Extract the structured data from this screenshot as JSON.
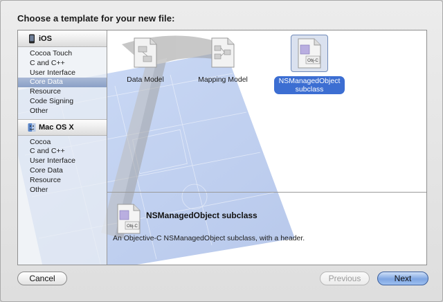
{
  "dialog": {
    "heading": "Choose a template for your new file:"
  },
  "sidebar": {
    "groups": [
      {
        "name": "iOS",
        "icon": "device-icon",
        "items": [
          "Cocoa Touch",
          "C and C++",
          "User Interface",
          "Core Data",
          "Resource",
          "Code Signing",
          "Other"
        ],
        "selected": "Core Data"
      },
      {
        "name": "Mac OS X",
        "icon": "finder-icon",
        "items": [
          "Cocoa",
          "C and C++",
          "User Interface",
          "Core Data",
          "Resource",
          "Other"
        ]
      }
    ]
  },
  "templates": [
    {
      "label": "Data Model",
      "icon": "data-model-document-icon"
    },
    {
      "label": "Mapping Model",
      "icon": "mapping-model-document-icon"
    },
    {
      "label_line1": "NSManagedObject",
      "label_line2": "subclass",
      "icon": "objc-class-document-icon",
      "badge": "Obj-C",
      "selected": true
    }
  ],
  "detail": {
    "title": "NSManagedObject subclass",
    "description": "An Objective-C NSManagedObject subclass, with a header.",
    "badge": "Obj-C"
  },
  "buttons": {
    "cancel": "Cancel",
    "previous": "Previous",
    "next": "Next"
  },
  "colors": {
    "selection": "#3c6ed2",
    "sidebar_selection": "#8aa0c6",
    "blueprint": "#6f90d6"
  }
}
